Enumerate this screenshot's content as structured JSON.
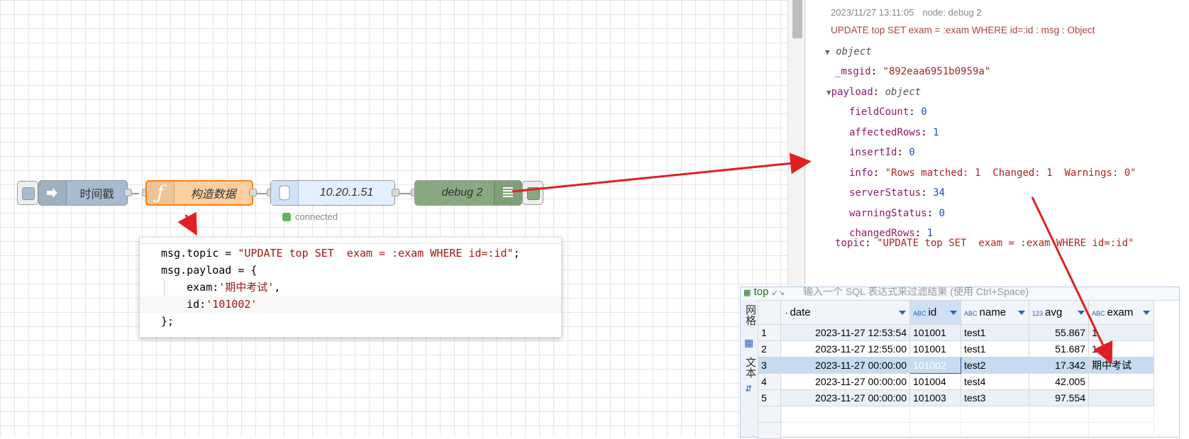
{
  "flow": {
    "inject": {
      "label": "时间戳",
      "color": "#a6bbcf"
    },
    "function": {
      "label": "构造数据",
      "color": "#fdd0a2",
      "icon": "function-icon"
    },
    "mysql": {
      "label": "10.20.1.51",
      "color": "#e2efff",
      "status": "connected",
      "status_color": "#5cb85c"
    },
    "debug": {
      "label": "debug 2",
      "color": "#87a980"
    }
  },
  "code": {
    "line1_a": "msg.topic = ",
    "line1_s": "\"UPDATE top SET  exam = :exam WHERE id=:id\"",
    "line1_b": ";",
    "line2": "msg.payload = {",
    "line3_a": "    exam:",
    "line3_s": "'期中考试'",
    "line3_b": ",",
    "line4_a": "    id:",
    "line4_s": "'101002'",
    "line5": "};"
  },
  "debug_panel": {
    "timestamp": "2023/11/27 13:11:05",
    "node": "node: debug 2",
    "topic_line": "UPDATE top SET exam = :exam WHERE id=:id : msg : Object",
    "root": "object",
    "msgid_key": "_msgid",
    "msgid_val": "\"892eaa6951b0959a\"",
    "payload_key": "payload",
    "payload_type": "object",
    "fields": [
      {
        "key": "fieldCount",
        "val": "0",
        "kind": "num"
      },
      {
        "key": "affectedRows",
        "val": "1",
        "kind": "num"
      },
      {
        "key": "insertId",
        "val": "0",
        "kind": "num"
      },
      {
        "key": "info",
        "val": "\"Rows matched: 1  Changed: 1  Warnings: 0\"",
        "kind": "str"
      },
      {
        "key": "serverStatus",
        "val": "34",
        "kind": "num"
      },
      {
        "key": "warningStatus",
        "val": "0",
        "kind": "num"
      },
      {
        "key": "changedRows",
        "val": "1",
        "kind": "num"
      }
    ],
    "topic_key": "topic",
    "topic_val": "\"UPDATE top SET  exam = :exam WHERE id=:id\""
  },
  "grid": {
    "table_name": "top",
    "filter_placeholder": "输入一个 SQL 表达式来过滤结果 (使用 Ctrl+Space)",
    "side_tabs": [
      "网格",
      "文本"
    ],
    "columns": [
      {
        "name": "date",
        "type": "clock-icon"
      },
      {
        "name": "id",
        "type": "ABC"
      },
      {
        "name": "name",
        "type": "ABC"
      },
      {
        "name": "avg",
        "type": "123"
      },
      {
        "name": "exam",
        "type": "ABC"
      }
    ],
    "rows": [
      {
        "n": "1",
        "date": "2023-11-27 12:53:54",
        "id": "101001",
        "name": "test1",
        "avg": "55.867",
        "exam": "1"
      },
      {
        "n": "2",
        "date": "2023-11-27 12:55:00",
        "id": "101001",
        "name": "test1",
        "avg": "51.687",
        "exam": "1"
      },
      {
        "n": "3",
        "date": "2023-11-27 00:00:00",
        "id": "101002",
        "name": "test2",
        "avg": "17.342",
        "exam": "期中考试"
      },
      {
        "n": "4",
        "date": "2023-11-27 00:00:00",
        "id": "101004",
        "name": "test4",
        "avg": "42.005",
        "exam": ""
      },
      {
        "n": "5",
        "date": "2023-11-27 00:00:00",
        "id": "101003",
        "name": "test3",
        "avg": "97.554",
        "exam": ""
      }
    ]
  }
}
